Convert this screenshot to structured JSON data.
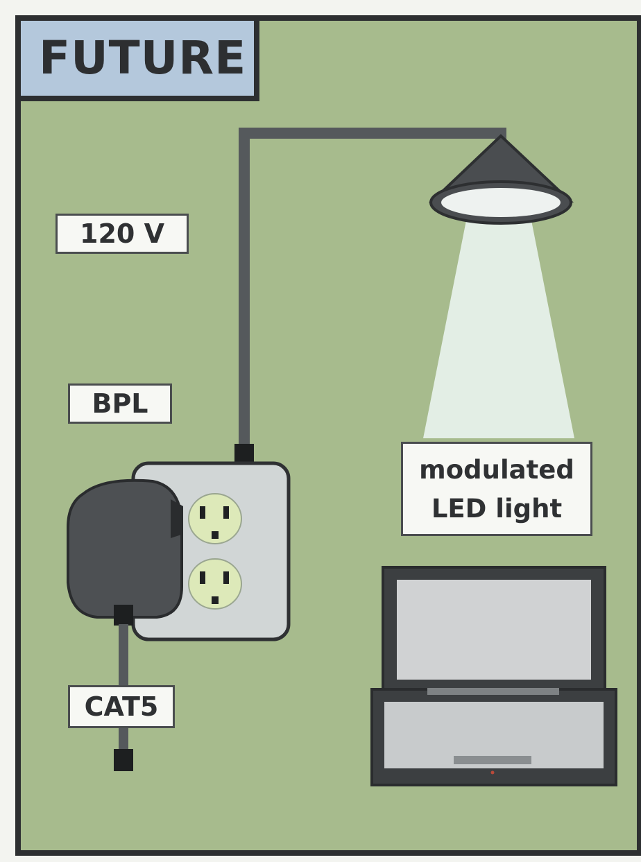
{
  "title": "FUTURE",
  "labels": {
    "voltage": "120 V",
    "bpl": "BPL",
    "cat5": "CAT5",
    "led": "modulated\nLED light"
  },
  "colors": {
    "background": "#a7bb8d",
    "title_box": "#b4c8dc",
    "frame": "#2d2f31",
    "cable": "#55595c",
    "outlet": "#d1d6d6",
    "receptacle": "#dde9b9",
    "adapter": "#4d5053",
    "light_beam": "#e6f0ea",
    "laptop_body": "#3c3f41",
    "laptop_screen": "#d0d2d3"
  },
  "icons": [
    "lamp-icon",
    "light-beam-icon",
    "wall-outlet-icon",
    "plug-adapter-icon",
    "laptop-icon"
  ]
}
